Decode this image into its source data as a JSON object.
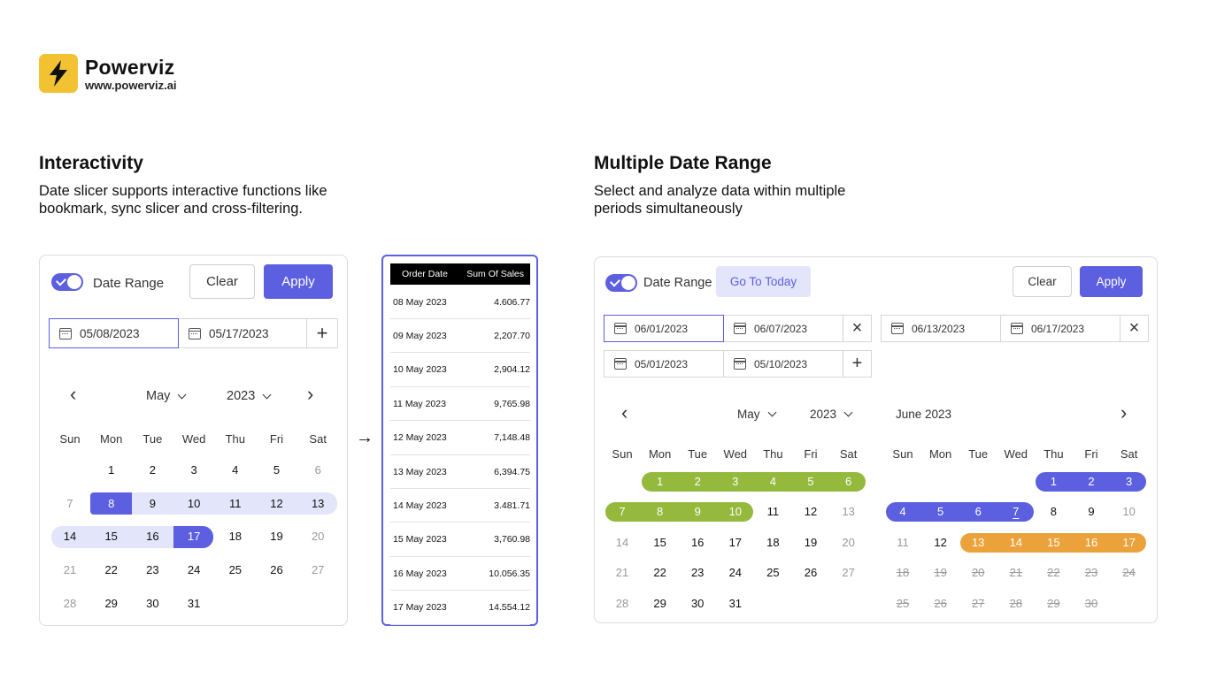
{
  "brand": {
    "name": "Powerviz",
    "url": "www.powerviz.ai"
  },
  "left_section": {
    "title": "Interactivity",
    "desc_line1": "Date slicer supports interactive functions like",
    "desc_line2": "bookmark, sync slicer and cross-filtering."
  },
  "right_section": {
    "title": "Multiple Date Range",
    "desc_line1": "Select and analyze data within multiple",
    "desc_line2": "periods simultaneously"
  },
  "slicer1": {
    "toggle_label": "Date Range",
    "clear_label": "Clear",
    "apply_label": "Apply",
    "start_date": "05/08/2023",
    "end_date": "05/17/2023",
    "add_symbol": "+",
    "prev_symbol": "‹",
    "next_symbol": "›",
    "month": "May",
    "year": "2023",
    "weekdays": [
      "Sun",
      "Mon",
      "Tue",
      "Wed",
      "Thu",
      "Fri",
      "Sat"
    ]
  },
  "arrow_symbol": "→",
  "table": {
    "headers": [
      "Order Date",
      "Sum Of Sales"
    ],
    "rows": [
      [
        "08 May 2023",
        "4.606.77"
      ],
      [
        "09 May 2023",
        "2,207.70"
      ],
      [
        "10 May 2023",
        "2,904.12"
      ],
      [
        "11 May 2023",
        "9,765.98"
      ],
      [
        "12 May 2023",
        "7,148.48"
      ],
      [
        "13 May 2023",
        "6,394.75"
      ],
      [
        "14 May 2023",
        "3.481.71"
      ],
      [
        "15 May 2023",
        "3,760.98"
      ],
      [
        "16 May 2023",
        "10.056.35"
      ],
      [
        "17 May 2023",
        "14.554.12"
      ]
    ]
  },
  "slicer2": {
    "toggle_label": "Date Range",
    "today_label": "Go To Today",
    "clear_label": "Clear",
    "apply_label": "Apply",
    "ranges": [
      {
        "start": "06/01/2023",
        "end": "06/07/2023",
        "action": "×"
      },
      {
        "start": "06/13/2023",
        "end": "06/17/2023",
        "action": "×"
      },
      {
        "start": "05/01/2023",
        "end": "05/10/2023",
        "action": "+"
      }
    ],
    "prev_symbol": "‹",
    "next_symbol": "›",
    "left_month": "May",
    "left_year": "2023",
    "right_month_label": "June 2023",
    "weekdays": [
      "Sun",
      "Mon",
      "Tue",
      "Wed",
      "Thu",
      "Fri",
      "Sat"
    ]
  },
  "colors": {
    "accent": "#5b5fe0",
    "accent_light": "#e3e5fb",
    "green": "#94b93c",
    "orange": "#eba23a",
    "logo_yellow": "#f2c232"
  }
}
